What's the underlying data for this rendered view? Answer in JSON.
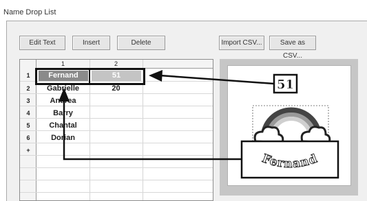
{
  "window": {
    "title": "Name Drop List"
  },
  "toolbar": {
    "edit_text": "Edit Text",
    "insert": "Insert",
    "delete": "Delete",
    "import_csv": "Import CSV...",
    "save_csv": "Save as CSV..."
  },
  "grid": {
    "columns": [
      "1",
      "2"
    ],
    "rows": [
      {
        "num": "1",
        "name": "Fernand",
        "value": "51"
      },
      {
        "num": "2",
        "name": "Gabrielle",
        "value": "20"
      },
      {
        "num": "3",
        "name": "Andrea",
        "value": ""
      },
      {
        "num": "4",
        "name": "Barry",
        "value": ""
      },
      {
        "num": "5",
        "name": "Chantal",
        "value": ""
      },
      {
        "num": "6",
        "name": "Dorian",
        "value": ""
      }
    ],
    "new_row_marker": "+"
  },
  "preview": {
    "number_callout": "51",
    "name_callout": "Fernand"
  },
  "colors": {
    "selected_cell": "#8a8a8a",
    "selected_cell_secondary": "#c4c4c4",
    "callout": "#111111"
  }
}
